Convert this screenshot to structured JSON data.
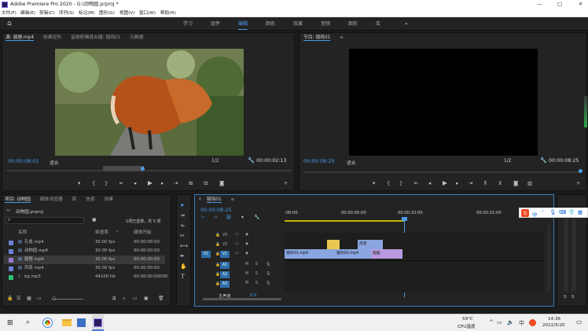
{
  "window": {
    "title": "Adobe Premiere Pro 2020 - G:\\动物园.prproj *",
    "controls": {
      "minimize": "—",
      "maximize": "□",
      "close": "✕"
    }
  },
  "menu": [
    "文件(F)",
    "编辑(E)",
    "剪辑(C)",
    "序列(S)",
    "标记(M)",
    "图形(G)",
    "视图(V)",
    "窗口(W)",
    "帮助(H)"
  ],
  "workspaces": [
    {
      "label": "学习",
      "active": false
    },
    {
      "label": "组件",
      "active": false
    },
    {
      "label": "编辑",
      "active": true
    },
    {
      "label": "颜色",
      "active": false
    },
    {
      "label": "效果",
      "active": false
    },
    {
      "label": "音频",
      "active": false
    },
    {
      "label": "图形",
      "active": false
    },
    {
      "label": "库",
      "active": false
    }
  ],
  "source": {
    "tabs": [
      "源: 狐狸.mp4",
      "效果控件",
      "音频剪辑混合器: 镜鸡01",
      "元数据"
    ],
    "timecode_in": "00:00:08:01",
    "fit": "适合",
    "scale": "1/2",
    "duration": "00:00:02:13"
  },
  "program": {
    "title": "节目: 镜鸡01",
    "timecode_in": "00:00:08:25",
    "fit": "适合",
    "scale": "1/2",
    "duration": "00:00:08:25"
  },
  "project": {
    "tabs": [
      "项目: 动物园",
      "媒体浏览器",
      "库",
      "信息",
      "效果"
    ],
    "file": "动物园.prproj",
    "selection": "1项已选择，共 5 项",
    "columns": [
      "名称",
      "帧速率",
      "媒体开始"
    ],
    "items": [
      {
        "name": "孔雀.mp4",
        "rate": "30.00 fps",
        "start": "00:00:00:00",
        "color": "#6a7fd6",
        "selected": false
      },
      {
        "name": "动物园.mp4",
        "rate": "30.00 fps",
        "start": "00:00:00:00",
        "color": "#6a7fd6",
        "selected": false
      },
      {
        "name": "狐狸.mp4",
        "rate": "30.00 fps",
        "start": "00:00:00:00",
        "color": "#9c7bd2",
        "selected": true
      },
      {
        "name": "风景.mp4",
        "rate": "30.00 fps",
        "start": "00:00:00:00",
        "color": "#6a7fd6",
        "selected": false
      },
      {
        "name": "bg.mp3",
        "rate": "44100 Hz",
        "start": "00:00:00:00000",
        "color": "#2fbf71",
        "selected": false
      }
    ]
  },
  "timeline": {
    "tab": "镜鸡01",
    "timecode": "00:00:08:25",
    "ruler": [
      ":00:00",
      "00:00:05:00",
      "00:00:10:00",
      "00:00:15:00"
    ],
    "video_tracks": [
      "V3",
      "V2",
      "V1"
    ],
    "audio_tracks": [
      "A1",
      "A2",
      "A3"
    ],
    "master": "主声道",
    "master_val": "0.0",
    "clips": [
      {
        "label": "镜鸡01.mp4",
        "track": "V1"
      },
      {
        "label": "镜鸡02.mp4",
        "track": "V1"
      },
      {
        "label": "狐狸",
        "track": "V1"
      },
      {
        "label": "风景",
        "track": "V2"
      }
    ]
  },
  "meter": {
    "labels": [
      "S",
      "S"
    ]
  },
  "taskbar": {
    "weather": "59°C",
    "weather_sub": "CPU温度",
    "time": "14:36",
    "date": "2022/5/20",
    "ime": "中"
  }
}
